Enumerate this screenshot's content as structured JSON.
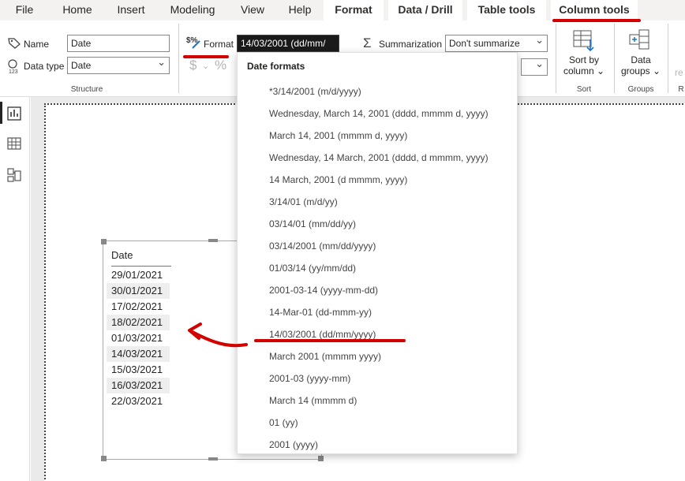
{
  "menu": {
    "tabs": [
      {
        "label": "File",
        "contextual": false
      },
      {
        "label": "Home",
        "contextual": false
      },
      {
        "label": "Insert",
        "contextual": false
      },
      {
        "label": "Modeling",
        "contextual": false
      },
      {
        "label": "View",
        "contextual": false
      },
      {
        "label": "Help",
        "contextual": false
      },
      {
        "label": "Format",
        "contextual": true
      },
      {
        "label": "Data / Drill",
        "contextual": true
      },
      {
        "label": "Table tools",
        "contextual": true
      },
      {
        "label": "Column tools",
        "contextual": true
      }
    ]
  },
  "ribbon": {
    "structure": {
      "name_label": "Name",
      "name_value": "Date",
      "datatype_label": "Data type",
      "datatype_value": "Date",
      "group_label": "Structure"
    },
    "formatting": {
      "format_label": "Format",
      "format_value": "14/03/2001 (dd/mm/",
      "currency_symbol": "$",
      "percent_symbol": "%"
    },
    "properties": {
      "summarization_label": "Summarization",
      "summarization_value": "Don't summarize"
    },
    "sort": {
      "button_line1": "Sort by",
      "button_line2": "column",
      "group_label": "Sort"
    },
    "groups": {
      "button_line1": "Data",
      "button_line2": "groups",
      "group_label": "Groups"
    },
    "cut_label": "re",
    "cut_group": "R"
  },
  "dropdown": {
    "title": "Date formats",
    "items": [
      "*3/14/2001 (m/d/yyyy)",
      "Wednesday, March 14, 2001 (dddd, mmmm d, yyyy)",
      "March 14, 2001 (mmmm d, yyyy)",
      "Wednesday, 14 March, 2001 (dddd, d mmmm, yyyy)",
      "14 March, 2001 (d mmmm, yyyy)",
      "3/14/01 (m/d/yy)",
      "03/14/01 (mm/dd/yy)",
      "03/14/2001 (mm/dd/yyyy)",
      "01/03/14 (yy/mm/dd)",
      "2001-03-14 (yyyy-mm-dd)",
      "14-Mar-01 (dd-mmm-yy)",
      "14/03/2001 (dd/mm/yyyy)",
      "March 2001 (mmmm yyyy)",
      "2001-03 (yyyy-mm)",
      "March 14 (mmmm d)",
      "01 (yy)",
      "2001 (yyyy)"
    ]
  },
  "table": {
    "column_header": "Date",
    "rows": [
      "29/01/2021",
      "30/01/2021",
      "17/02/2021",
      "18/02/2021",
      "01/03/2021",
      "14/03/2021",
      "15/03/2021",
      "16/03/2021",
      "22/03/2021"
    ]
  },
  "colors": {
    "annotation_red": "#d40000",
    "accent_blue": "#118dff"
  }
}
